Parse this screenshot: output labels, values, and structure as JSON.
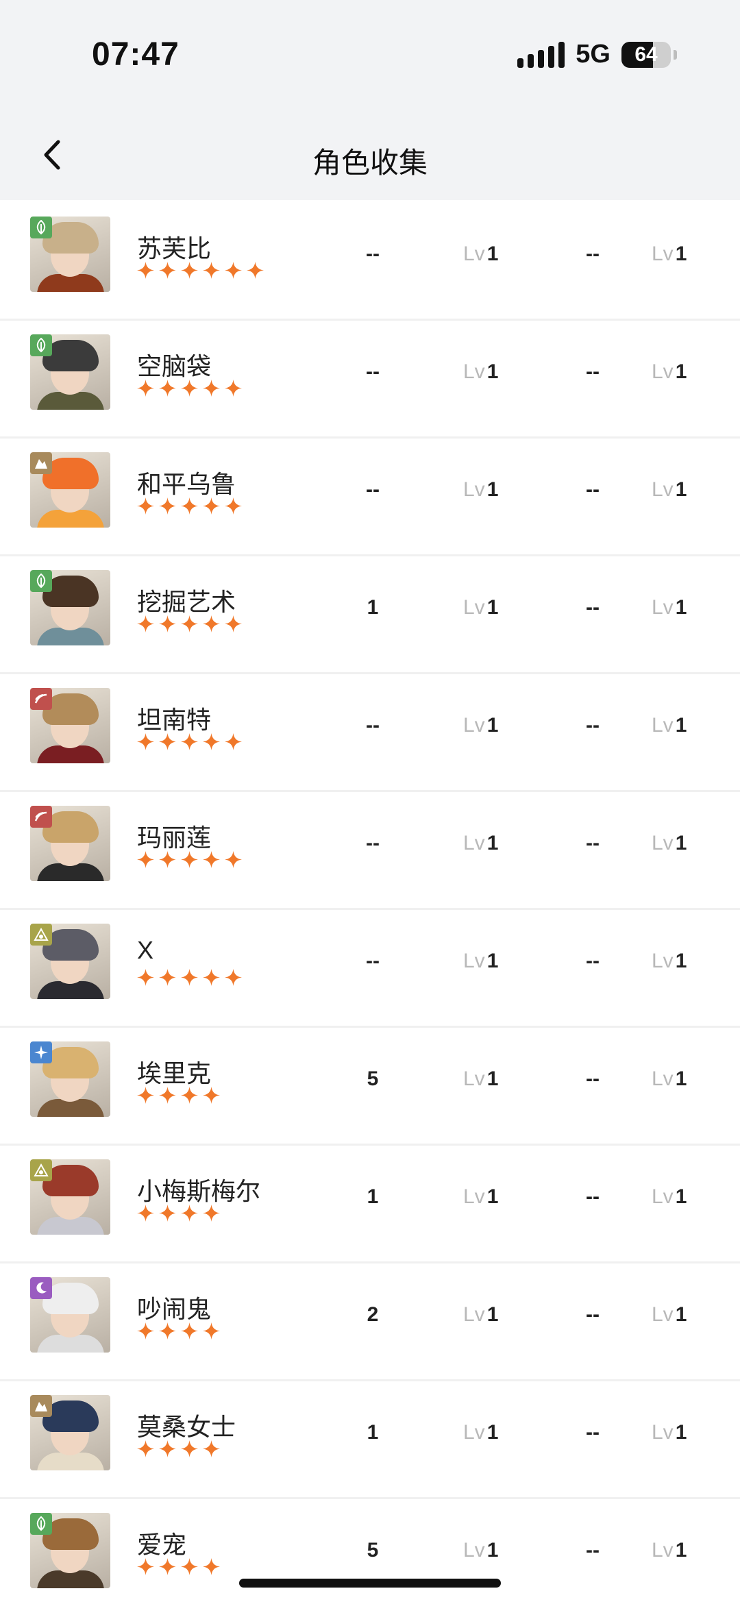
{
  "status_bar": {
    "time": "07:47",
    "network": "5G",
    "battery": "64",
    "battery_level": 0.64
  },
  "header": {
    "title": "角色收集",
    "back_icon": "chevron-left-icon"
  },
  "lv_prefix": "Lv",
  "star_color": "#f0782a",
  "characters": [
    {
      "name": "苏芙比",
      "stars": 6,
      "element_icon": "leaf-icon",
      "element_color": "#57a85b",
      "col1": "--",
      "lv1": "1",
      "col3": "--",
      "lv2": "1",
      "hair": "#c8b08a",
      "outfit": "#8f3a1c"
    },
    {
      "name": "空脑袋",
      "stars": 5,
      "element_icon": "leaf-icon",
      "element_color": "#57a85b",
      "col1": "--",
      "lv1": "1",
      "col3": "--",
      "lv2": "1",
      "hair": "#3b3b3b",
      "outfit": "#5a5a3a"
    },
    {
      "name": "和平乌鲁",
      "stars": 5,
      "element_icon": "rock-icon",
      "element_color": "#a88a5c",
      "col1": "--",
      "lv1": "1",
      "col3": "--",
      "lv2": "1",
      "hair": "#f0702a",
      "outfit": "#f4a23a"
    },
    {
      "name": "挖掘艺术",
      "stars": 5,
      "element_icon": "leaf-icon",
      "element_color": "#57a85b",
      "col1": "1",
      "lv1": "1",
      "col3": "--",
      "lv2": "1",
      "hair": "#4a3424",
      "outfit": "#6f8f9a"
    },
    {
      "name": "坦南特",
      "stars": 5,
      "element_icon": "beast-icon",
      "element_color": "#c0504d",
      "col1": "--",
      "lv1": "1",
      "col3": "--",
      "lv2": "1",
      "hair": "#b28c5a",
      "outfit": "#7a1e22"
    },
    {
      "name": "玛丽莲",
      "stars": 5,
      "element_icon": "beast-icon",
      "element_color": "#c0504d",
      "col1": "--",
      "lv1": "1",
      "col3": "--",
      "lv2": "1",
      "hair": "#c9a46a",
      "outfit": "#2a2a2a"
    },
    {
      "name": "X",
      "stars": 5,
      "element_icon": "star-triangle-icon",
      "element_color": "#a8a44a",
      "col1": "--",
      "lv1": "1",
      "col3": "--",
      "lv2": "1",
      "hair": "#5c5c66",
      "outfit": "#2a2a30"
    },
    {
      "name": "埃里克",
      "stars": 4,
      "element_icon": "sparkle-icon",
      "element_color": "#4a86d0",
      "col1": "5",
      "lv1": "1",
      "col3": "--",
      "lv2": "1",
      "hair": "#d9b270",
      "outfit": "#7a5a3a"
    },
    {
      "name": "小梅斯梅尔",
      "stars": 4,
      "element_icon": "star-triangle-icon",
      "element_color": "#a8a44a",
      "col1": "1",
      "lv1": "1",
      "col3": "--",
      "lv2": "1",
      "hair": "#9a3a2a",
      "outfit": "#c8c8d0"
    },
    {
      "name": "吵闹鬼",
      "stars": 4,
      "element_icon": "moon-icon",
      "element_color": "#9a5cc0",
      "col1": "2",
      "lv1": "1",
      "col3": "--",
      "lv2": "1",
      "hair": "#eeeeee",
      "outfit": "#dddddd"
    },
    {
      "name": "莫桑女士",
      "stars": 4,
      "element_icon": "rock-icon",
      "element_color": "#a88a5c",
      "col1": "1",
      "lv1": "1",
      "col3": "--",
      "lv2": "1",
      "hair": "#2a3a5a",
      "outfit": "#e6dcc8"
    },
    {
      "name": "爱宠",
      "stars": 4,
      "element_icon": "leaf-icon",
      "element_color": "#57a85b",
      "col1": "5",
      "lv1": "1",
      "col3": "--",
      "lv2": "1",
      "hair": "#9a6a3a",
      "outfit": "#4a3a2a"
    }
  ]
}
